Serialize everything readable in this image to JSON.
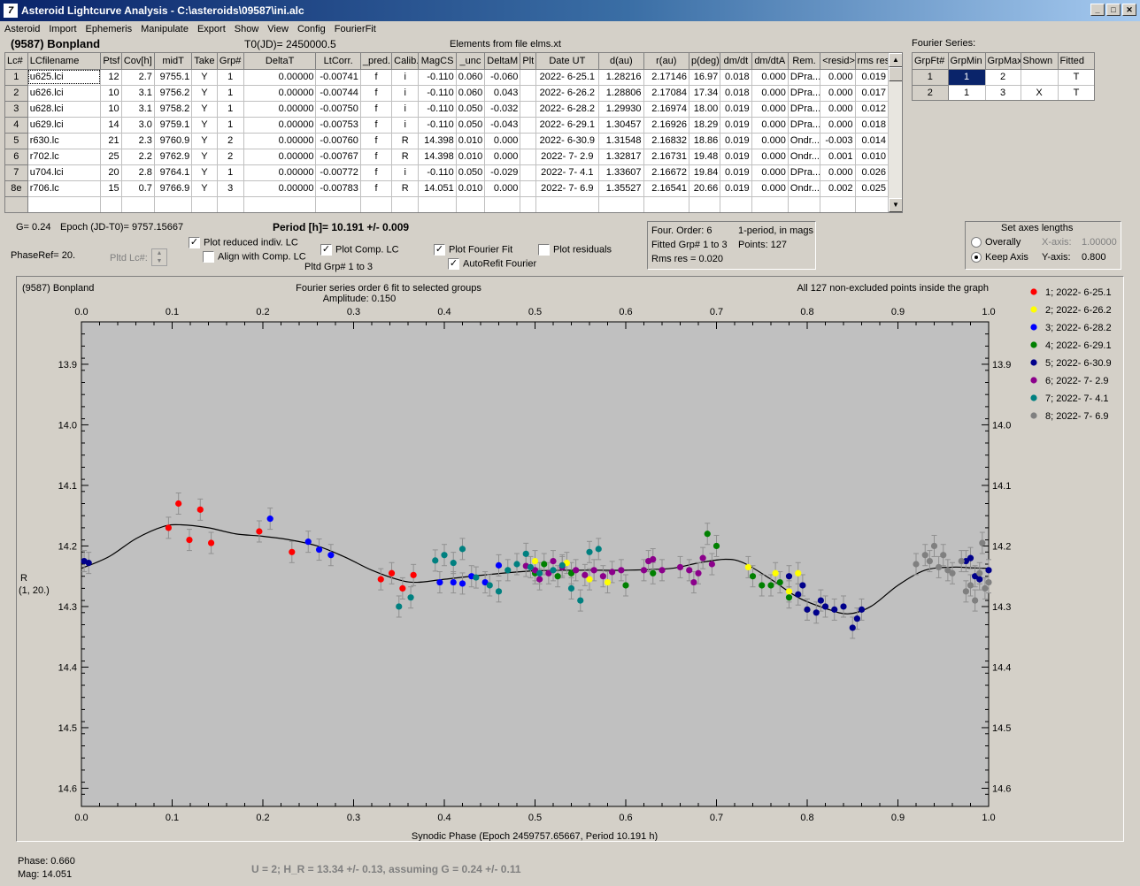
{
  "window": {
    "title": "Asteroid Lightcurve Analysis - C:\\asteroids\\09587\\ini.alc",
    "icon_text": "7"
  },
  "menu": [
    "Asteroid",
    "Import",
    "Ephemeris",
    "Manipulate",
    "Export",
    "Show",
    "View",
    "Config",
    "FourierFit"
  ],
  "header": {
    "asteroid": "(9587) Bonpland",
    "t0": "T0(JD)= 2450000.5",
    "elements": "Elements from file elms.xt"
  },
  "lc_table": {
    "columns": [
      "Lc#",
      "LCfilename",
      "Ptsf",
      "Cov[h]",
      "midT",
      "Take",
      "Grp#",
      "DeltaT",
      "LtCorr.",
      "_pred.",
      "Calib.",
      "MagCS",
      "_unc",
      "DeltaM",
      "Plt",
      "Date UT",
      "d(au)",
      "r(au)",
      "p(deg)",
      "dm/dt",
      "dm/dtA",
      "Rem.",
      "<resid>",
      "rms res"
    ],
    "rows": [
      [
        "1",
        "u625.lci",
        "12",
        "2.7",
        "9755.1",
        "Y",
        "1",
        "0.00000",
        "-0.00741",
        "f",
        "i",
        "-0.110",
        "0.060",
        "-0.060",
        "",
        "2022- 6-25.1",
        "1.28216",
        "2.17146",
        "16.97",
        "0.018",
        "0.000",
        "DPra...",
        "0.000",
        "0.019"
      ],
      [
        "2",
        "u626.lci",
        "10",
        "3.1",
        "9756.2",
        "Y",
        "1",
        "0.00000",
        "-0.00744",
        "f",
        "i",
        "-0.110",
        "0.060",
        "0.043",
        "",
        "2022- 6-26.2",
        "1.28806",
        "2.17084",
        "17.34",
        "0.018",
        "0.000",
        "DPra...",
        "0.000",
        "0.017"
      ],
      [
        "3",
        "u628.lci",
        "10",
        "3.1",
        "9758.2",
        "Y",
        "1",
        "0.00000",
        "-0.00750",
        "f",
        "i",
        "-0.110",
        "0.050",
        "-0.032",
        "",
        "2022- 6-28.2",
        "1.29930",
        "2.16974",
        "18.00",
        "0.019",
        "0.000",
        "DPra...",
        "0.000",
        "0.012"
      ],
      [
        "4",
        "u629.lci",
        "14",
        "3.0",
        "9759.1",
        "Y",
        "1",
        "0.00000",
        "-0.00753",
        "f",
        "i",
        "-0.110",
        "0.050",
        "-0.043",
        "",
        "2022- 6-29.1",
        "1.30457",
        "2.16926",
        "18.29",
        "0.019",
        "0.000",
        "DPra...",
        "0.000",
        "0.018"
      ],
      [
        "5",
        "r630.lc",
        "21",
        "2.3",
        "9760.9",
        "Y",
        "2",
        "0.00000",
        "-0.00760",
        "f",
        "R",
        "14.398",
        "0.010",
        "0.000",
        "",
        "2022- 6-30.9",
        "1.31548",
        "2.16832",
        "18.86",
        "0.019",
        "0.000",
        "Ondr...",
        "-0.003",
        "0.014"
      ],
      [
        "6",
        "r702.lc",
        "25",
        "2.2",
        "9762.9",
        "Y",
        "2",
        "0.00000",
        "-0.00767",
        "f",
        "R",
        "14.398",
        "0.010",
        "0.000",
        "",
        "2022- 7- 2.9",
        "1.32817",
        "2.16731",
        "19.48",
        "0.019",
        "0.000",
        "Ondr...",
        "0.001",
        "0.010"
      ],
      [
        "7",
        "u704.lci",
        "20",
        "2.8",
        "9764.1",
        "Y",
        "1",
        "0.00000",
        "-0.00772",
        "f",
        "i",
        "-0.110",
        "0.050",
        "-0.029",
        "",
        "2022- 7- 4.1",
        "1.33607",
        "2.16672",
        "19.84",
        "0.019",
        "0.000",
        "DPra...",
        "0.000",
        "0.026"
      ],
      [
        "8e",
        "r706.lc",
        "15",
        "0.7",
        "9766.9",
        "Y",
        "3",
        "0.00000",
        "-0.00783",
        "f",
        "R",
        "14.051",
        "0.010",
        "0.000",
        "",
        "2022- 7- 6.9",
        "1.35527",
        "2.16541",
        "20.66",
        "0.019",
        "0.000",
        "Ondr...",
        "0.002",
        "0.025"
      ]
    ]
  },
  "fourier_series": {
    "label": "Fourier Series:",
    "columns": [
      "GrpFt#",
      "GrpMin",
      "GrpMax",
      "Shown",
      "Fitted"
    ],
    "rows": [
      [
        "1",
        "1",
        "2",
        "",
        "T"
      ],
      [
        "2",
        "1",
        "3",
        "X",
        "T"
      ]
    ]
  },
  "info": {
    "g": "G= 0.24",
    "epoch": "Epoch (JD-T0)= 9757.15667",
    "period": "Period [h]= 10.191 +/- 0.009",
    "phaseref": "PhaseRef= 20.",
    "pltd_lc": "Pltd Lc#:",
    "pltd_grp": "Pltd Grp#  1   to   3"
  },
  "checkboxes": {
    "reduced": {
      "label": "Plot reduced indiv. LC",
      "checked": true
    },
    "align": {
      "label": "Align with Comp. LC",
      "checked": false
    },
    "comp": {
      "label": "Plot Comp. LC",
      "checked": true
    },
    "fourier": {
      "label": "Plot Fourier Fit",
      "checked": true
    },
    "residuals": {
      "label": "Plot residuals",
      "checked": false
    },
    "autorefit": {
      "label": "AutoRefit Fourier",
      "checked": true
    }
  },
  "fit_info": {
    "order": "Four. Order:  6",
    "period_note": "1-period, in mags",
    "fitted": "Fitted Grp# 1 to 3",
    "points": "Points: 127",
    "rms": "Rms res     = 0.020"
  },
  "axes_box": {
    "title": "Set axes lengths",
    "overall": "Overally",
    "keep": "Keep Axis",
    "xaxis_label": "X-axis:",
    "xaxis_val": "1.00000",
    "yaxis_label": "Y-axis:",
    "yaxis_val": "0.800"
  },
  "chart_data": {
    "type": "scatter",
    "title_left": "(9587) Bonpland",
    "title_center": "Fourier series order 6 fit to selected groups",
    "subtitle": "Amplitude: 0.150",
    "title_right": "All 127 non-excluded points inside the graph",
    "xlabel": "Synodic Phase (Epoch 2459757.65667, Period 10.191 h)",
    "ylabel": "R",
    "ylabel2": "(1, 20.)",
    "xlim": [
      0,
      1
    ],
    "ylim": [
      13.83,
      14.63
    ],
    "y_inverted": true,
    "xticks": [
      "0.0",
      "0.1",
      "0.2",
      "0.3",
      "0.4",
      "0.5",
      "0.6",
      "0.7",
      "0.8",
      "0.9",
      "1.0"
    ],
    "yticks": [
      "13.9",
      "14.0",
      "14.1",
      "14.2",
      "14.3",
      "14.4",
      "14.5",
      "14.6"
    ],
    "grid": false,
    "legend_position": "right",
    "series": [
      {
        "name": "1; 2022- 6-25.1",
        "color": "#ff0000",
        "points": [
          [
            0.096,
            14.17
          ],
          [
            0.107,
            14.13
          ],
          [
            0.119,
            14.19
          ],
          [
            0.131,
            14.14
          ],
          [
            0.143,
            14.195
          ],
          [
            0.196,
            14.176
          ],
          [
            0.232,
            14.21
          ],
          [
            0.33,
            14.255
          ],
          [
            0.342,
            14.245
          ],
          [
            0.354,
            14.27
          ],
          [
            0.366,
            14.248
          ]
        ]
      },
      {
        "name": "2; 2022- 6-26.2",
        "color": "#ffff00",
        "points": [
          [
            0.5,
            14.225
          ],
          [
            0.535,
            14.228
          ],
          [
            0.56,
            14.255
          ],
          [
            0.58,
            14.26
          ],
          [
            0.735,
            14.235
          ],
          [
            0.765,
            14.245
          ],
          [
            0.78,
            14.275
          ],
          [
            0.79,
            14.245
          ],
          [
            0.8,
            14.305
          ]
        ]
      },
      {
        "name": "3; 2022- 6-28.2",
        "color": "#0000ff",
        "points": [
          [
            0.208,
            14.155
          ],
          [
            0.25,
            14.193
          ],
          [
            0.262,
            14.206
          ],
          [
            0.275,
            14.215
          ],
          [
            0.395,
            14.26
          ],
          [
            0.41,
            14.26
          ],
          [
            0.42,
            14.262
          ],
          [
            0.43,
            14.25
          ],
          [
            0.445,
            14.26
          ],
          [
            0.46,
            14.232
          ]
        ]
      },
      {
        "name": "4; 2022- 6-29.1",
        "color": "#008000",
        "points": [
          [
            0.5,
            14.245
          ],
          [
            0.51,
            14.23
          ],
          [
            0.525,
            14.25
          ],
          [
            0.54,
            14.245
          ],
          [
            0.6,
            14.265
          ],
          [
            0.63,
            14.245
          ],
          [
            0.69,
            14.18
          ],
          [
            0.7,
            14.2
          ],
          [
            0.74,
            14.25
          ],
          [
            0.75,
            14.265
          ],
          [
            0.76,
            14.265
          ],
          [
            0.77,
            14.26
          ],
          [
            0.78,
            14.285
          ]
        ]
      },
      {
        "name": "5; 2022- 6-30.9",
        "color": "#00008b",
        "points": [
          [
            0.003,
            14.225
          ],
          [
            0.008,
            14.228
          ],
          [
            0.78,
            14.25
          ],
          [
            0.79,
            14.28
          ],
          [
            0.8,
            14.305
          ],
          [
            0.81,
            14.31
          ],
          [
            0.82,
            14.3
          ],
          [
            0.83,
            14.305
          ],
          [
            0.84,
            14.3
          ],
          [
            0.85,
            14.335
          ],
          [
            0.855,
            14.32
          ],
          [
            0.86,
            14.305
          ],
          [
            0.975,
            14.225
          ],
          [
            0.98,
            14.22
          ],
          [
            0.985,
            14.25
          ],
          [
            0.99,
            14.255
          ],
          [
            1.0,
            14.24
          ],
          [
            0.795,
            14.265
          ],
          [
            0.815,
            14.29
          ]
        ]
      },
      {
        "name": "6; 2022- 7- 2.9",
        "color": "#8b008b",
        "points": [
          [
            0.49,
            14.233
          ],
          [
            0.5,
            14.24
          ],
          [
            0.515,
            14.245
          ],
          [
            0.53,
            14.235
          ],
          [
            0.545,
            14.24
          ],
          [
            0.555,
            14.248
          ],
          [
            0.565,
            14.24
          ],
          [
            0.575,
            14.25
          ],
          [
            0.585,
            14.243
          ],
          [
            0.595,
            14.24
          ],
          [
            0.62,
            14.24
          ],
          [
            0.625,
            14.225
          ],
          [
            0.63,
            14.222
          ],
          [
            0.64,
            14.24
          ],
          [
            0.66,
            14.235
          ],
          [
            0.67,
            14.24
          ],
          [
            0.675,
            14.26
          ],
          [
            0.68,
            14.245
          ],
          [
            0.685,
            14.22
          ],
          [
            0.695,
            14.23
          ],
          [
            0.505,
            14.255
          ],
          [
            0.52,
            14.225
          ]
        ]
      },
      {
        "name": "7; 2022- 7- 4.1",
        "color": "#008080",
        "points": [
          [
            0.35,
            14.3
          ],
          [
            0.363,
            14.285
          ],
          [
            0.39,
            14.224
          ],
          [
            0.4,
            14.215
          ],
          [
            0.41,
            14.228
          ],
          [
            0.42,
            14.205
          ],
          [
            0.435,
            14.252
          ],
          [
            0.45,
            14.265
          ],
          [
            0.46,
            14.275
          ],
          [
            0.47,
            14.24
          ],
          [
            0.48,
            14.23
          ],
          [
            0.49,
            14.213
          ],
          [
            0.495,
            14.235
          ],
          [
            0.505,
            14.245
          ],
          [
            0.52,
            14.24
          ],
          [
            0.53,
            14.232
          ],
          [
            0.54,
            14.27
          ],
          [
            0.55,
            14.29
          ],
          [
            0.56,
            14.21
          ],
          [
            0.57,
            14.205
          ]
        ]
      },
      {
        "name": "8; 2022- 7- 6.9",
        "color": "#808080",
        "points": [
          [
            0.92,
            14.23
          ],
          [
            0.93,
            14.215
          ],
          [
            0.935,
            14.225
          ],
          [
            0.94,
            14.2
          ],
          [
            0.945,
            14.235
          ],
          [
            0.95,
            14.215
          ],
          [
            0.955,
            14.24
          ],
          [
            0.96,
            14.245
          ],
          [
            0.97,
            14.225
          ],
          [
            0.975,
            14.275
          ],
          [
            0.98,
            14.265
          ],
          [
            0.985,
            14.29
          ],
          [
            0.99,
            14.245
          ],
          [
            0.993,
            14.195
          ],
          [
            0.996,
            14.27
          ],
          [
            1.0,
            14.26
          ]
        ]
      }
    ],
    "fourier_curve": [
      [
        0,
        14.237
      ],
      [
        0.03,
        14.218
      ],
      [
        0.06,
        14.188
      ],
      [
        0.09,
        14.168
      ],
      [
        0.11,
        14.165
      ],
      [
        0.14,
        14.17
      ],
      [
        0.17,
        14.18
      ],
      [
        0.2,
        14.184
      ],
      [
        0.23,
        14.19
      ],
      [
        0.26,
        14.2
      ],
      [
        0.29,
        14.218
      ],
      [
        0.32,
        14.24
      ],
      [
        0.35,
        14.256
      ],
      [
        0.37,
        14.26
      ],
      [
        0.4,
        14.255
      ],
      [
        0.45,
        14.247
      ],
      [
        0.5,
        14.241
      ],
      [
        0.55,
        14.24
      ],
      [
        0.6,
        14.24
      ],
      [
        0.65,
        14.237
      ],
      [
        0.68,
        14.228
      ],
      [
        0.71,
        14.222
      ],
      [
        0.73,
        14.228
      ],
      [
        0.76,
        14.255
      ],
      [
        0.79,
        14.285
      ],
      [
        0.82,
        14.303
      ],
      [
        0.845,
        14.312
      ],
      [
        0.87,
        14.3
      ],
      [
        0.9,
        14.265
      ],
      [
        0.93,
        14.24
      ],
      [
        0.96,
        14.235
      ],
      [
        0.98,
        14.236
      ],
      [
        1.0,
        14.237
      ]
    ]
  },
  "status": {
    "phase": "Phase:  0.660",
    "mag": "Mag:     14.051",
    "h_r": "U = 2; H_R = 13.34 +/- 0.13, assuming G = 0.24 +/- 0.11"
  },
  "colors": {
    "titlebar": "#0a246a",
    "plot_bg": "#c0c0c0",
    "selected_cell": "#0a246a"
  }
}
